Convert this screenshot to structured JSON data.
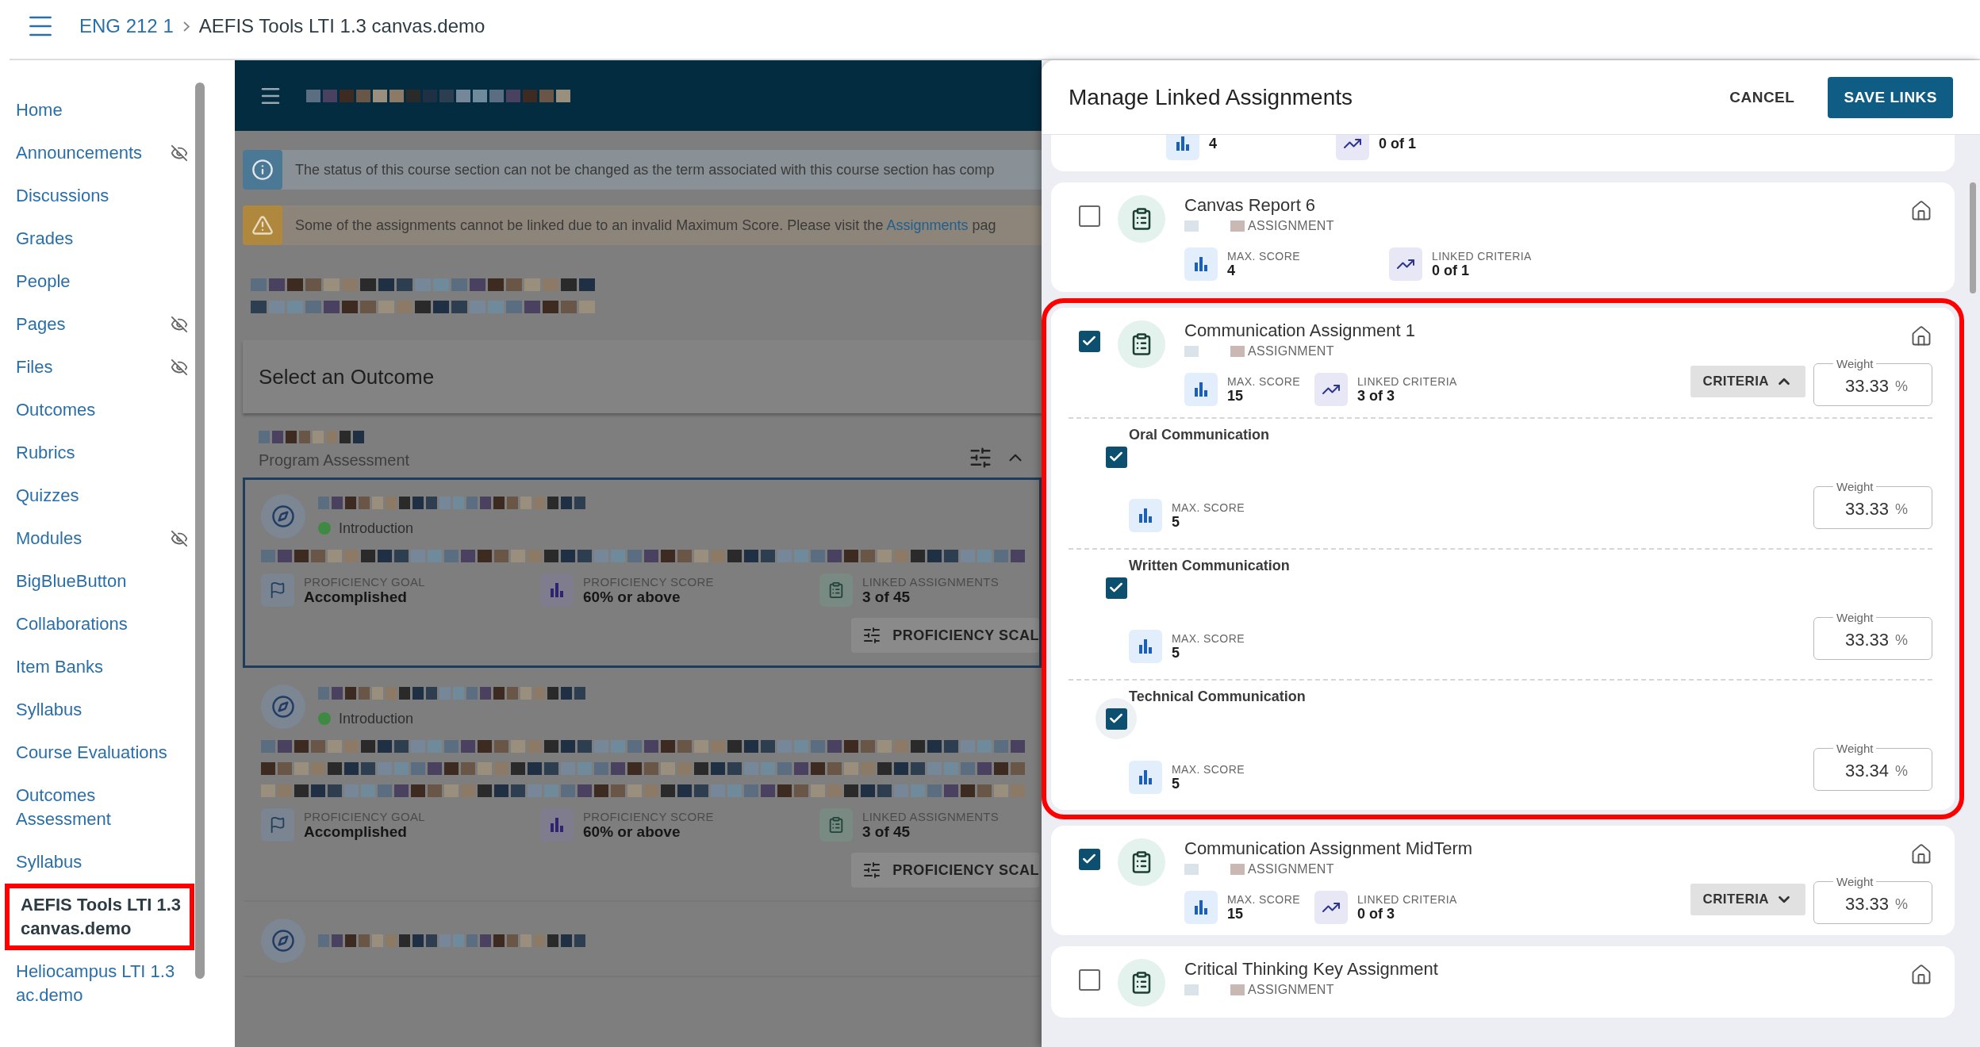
{
  "breadcrumb": [
    "ENG 212 1",
    "AEFIS Tools LTI 1.3 canvas.demo"
  ],
  "sidebar": {
    "items": [
      {
        "label": "Home",
        "hidden": false,
        "selected": false,
        "highlighted": false
      },
      {
        "label": "Announcements",
        "hidden": true,
        "selected": false,
        "highlighted": false
      },
      {
        "label": "Discussions",
        "hidden": false,
        "selected": false,
        "highlighted": false
      },
      {
        "label": "Grades",
        "hidden": false,
        "selected": false,
        "highlighted": false
      },
      {
        "label": "People",
        "hidden": false,
        "selected": false,
        "highlighted": false
      },
      {
        "label": "Pages",
        "hidden": true,
        "selected": false,
        "highlighted": false
      },
      {
        "label": "Files",
        "hidden": true,
        "selected": false,
        "highlighted": false
      },
      {
        "label": "Outcomes",
        "hidden": false,
        "selected": false,
        "highlighted": false
      },
      {
        "label": "Rubrics",
        "hidden": false,
        "selected": false,
        "highlighted": false
      },
      {
        "label": "Quizzes",
        "hidden": false,
        "selected": false,
        "highlighted": false
      },
      {
        "label": "Modules",
        "hidden": true,
        "selected": false,
        "highlighted": false
      },
      {
        "label": "BigBlueButton",
        "hidden": false,
        "selected": false,
        "highlighted": false
      },
      {
        "label": "Collaborations",
        "hidden": false,
        "selected": false,
        "highlighted": false
      },
      {
        "label": "Item Banks",
        "hidden": false,
        "selected": false,
        "highlighted": false
      },
      {
        "label": "Syllabus",
        "hidden": false,
        "selected": false,
        "highlighted": false
      },
      {
        "label": "Course Evaluations",
        "hidden": false,
        "selected": false,
        "highlighted": false
      },
      {
        "label": "Outcomes Assessment",
        "hidden": false,
        "selected": false,
        "highlighted": false
      },
      {
        "label": "Syllabus",
        "hidden": false,
        "selected": false,
        "highlighted": false
      },
      {
        "label": "AEFIS Tools LTI 1.3 canvas.demo",
        "hidden": false,
        "selected": true,
        "highlighted": true
      },
      {
        "label": "Heliocampus LTI 1.3 ac.demo",
        "hidden": false,
        "selected": false,
        "highlighted": false
      }
    ]
  },
  "main": {
    "info_banner": "The status of this course section can not be changed as the term associated with this course section has comp",
    "warning_banner": {
      "text": "Some of the assignments cannot be linked due to an invalid Maximum Score. Please visit the",
      "link": "Assignments",
      "after": "pag"
    },
    "panel_title": "Select an Outcome",
    "section_label": "Program Assessment",
    "outcomes": [
      {
        "kind": "short",
        "selected": true,
        "level": "Introduction",
        "stats": [
          {
            "kind": "goal",
            "label": "PROFICIENCY GOAL",
            "value": "Accomplished"
          },
          {
            "kind": "score",
            "label": "PROFICIENCY SCORE",
            "value": "60% or above"
          },
          {
            "kind": "assignments",
            "label": "LINKED ASSIGNMENTS",
            "value": "3 of 45"
          }
        ],
        "button": "PROFICIENCY SCAL"
      },
      {
        "kind": "long",
        "selected": false,
        "level": "Introduction",
        "stats": [
          {
            "kind": "goal",
            "label": "PROFICIENCY GOAL",
            "value": "Accomplished"
          },
          {
            "kind": "score",
            "label": "PROFICIENCY SCORE",
            "value": "60% or above"
          },
          {
            "kind": "assignments",
            "label": "LINKED ASSIGNMENTS",
            "value": "3 of 45"
          }
        ],
        "button": "PROFICIENCY SCAL"
      },
      {
        "kind": "cut",
        "selected": false
      }
    ]
  },
  "drawer": {
    "title": "Manage Linked Assignments",
    "cancel": "CANCEL",
    "save": "SAVE LINKS",
    "assignments": [
      {
        "kind": "partial",
        "stats": [
          {
            "kind": "max_score",
            "value": "4"
          },
          {
            "kind": "linked_criteria",
            "value": "0 of 1"
          }
        ]
      },
      {
        "kind": "full",
        "title": "Canvas Report 6",
        "type": "ASSIGNMENT",
        "checked": false,
        "highlighted": false,
        "stats": [
          {
            "kind": "max_score",
            "label": "MAX. SCORE",
            "value": "4"
          },
          {
            "kind": "linked_criteria",
            "label": "LINKED CRITERIA",
            "value": "0 of 1"
          }
        ]
      },
      {
        "kind": "full",
        "title": "Communication Assignment 1",
        "type": "ASSIGNMENT",
        "checked": true,
        "highlighted": true,
        "stats": [
          {
            "kind": "max_score",
            "label": "MAX. SCORE",
            "value": "15"
          },
          {
            "kind": "linked_criteria",
            "label": "LINKED CRITERIA",
            "value": "3 of 3"
          }
        ],
        "criteria_button": {
          "label": "CRITERIA",
          "expanded": true
        },
        "weight": {
          "label": "Weight",
          "value": "33.33",
          "unit": "%"
        },
        "criteria": [
          {
            "name": "Oral Communication",
            "checked": true,
            "focused": false,
            "label": "MAX. SCORE",
            "value": "5",
            "weight": {
              "label": "Weight",
              "value": "33.33",
              "unit": "%"
            }
          },
          {
            "name": "Written Communication",
            "checked": true,
            "focused": false,
            "label": "MAX. SCORE",
            "value": "5",
            "weight": {
              "label": "Weight",
              "value": "33.33",
              "unit": "%"
            }
          },
          {
            "name": "Technical Communication",
            "checked": true,
            "focused": true,
            "label": "MAX. SCORE",
            "value": "5",
            "weight": {
              "label": "Weight",
              "value": "33.34",
              "unit": "%"
            }
          }
        ]
      },
      {
        "kind": "full",
        "title": "Communication Assignment MidTerm",
        "type": "ASSIGNMENT",
        "checked": true,
        "highlighted": false,
        "stats": [
          {
            "kind": "max_score",
            "label": "MAX. SCORE",
            "value": "15"
          },
          {
            "kind": "linked_criteria",
            "label": "LINKED CRITERIA",
            "value": "0 of 3"
          }
        ],
        "criteria_button": {
          "label": "CRITERIA",
          "expanded": false
        },
        "weight": {
          "label": "Weight",
          "value": "33.33",
          "unit": "%"
        }
      },
      {
        "kind": "full",
        "title": "Critical Thinking Key Assignment",
        "type": "ASSIGNMENT",
        "checked": false,
        "highlighted": false
      }
    ]
  }
}
